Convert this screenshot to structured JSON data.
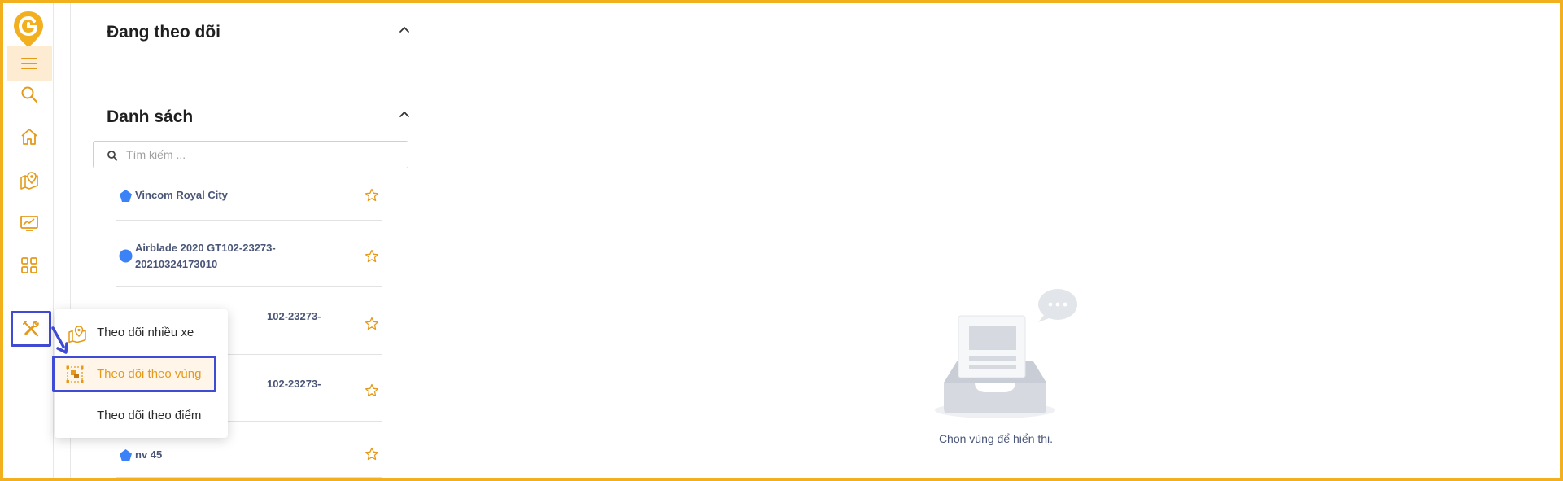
{
  "app": {
    "brand_color": "#f2b01e",
    "accent_color": "#e59a1a",
    "highlight_color": "#3f4bd4",
    "logo_letter": "G"
  },
  "rail": {
    "items": [
      {
        "icon": "menu-icon"
      },
      {
        "icon": "search-icon"
      },
      {
        "icon": "home-icon"
      },
      {
        "icon": "map-pin-icon"
      },
      {
        "icon": "monitor-chart-icon"
      },
      {
        "icon": "apps-grid-icon"
      },
      {
        "icon": "tools-icon"
      }
    ]
  },
  "panel": {
    "following_title": "Đang theo dõi",
    "list_title": "Danh sách",
    "search_placeholder": "Tìm kiếm ...",
    "items": [
      {
        "name": "Vincom Royal City",
        "shape": "pentagon",
        "color": "#3b82f6"
      },
      {
        "name": "Airblade 2020 GT102-23273-20210324173010",
        "shape": "circle",
        "color": "#3b82f6"
      },
      {
        "name": "102-23273-",
        "shape": "circle",
        "color": "#3b82f6"
      },
      {
        "name": "102-23273-",
        "shape": "circle",
        "color": "#3b82f6"
      },
      {
        "name": "nv 45",
        "shape": "pentagon",
        "color": "#3b82f6"
      }
    ]
  },
  "menu": {
    "items": [
      {
        "label": "Theo dõi nhiều xe",
        "icon": "map-marker-icon"
      },
      {
        "label": "Theo dõi theo vùng",
        "icon": "zone-select-icon",
        "selected": true
      },
      {
        "label": "Theo dõi theo điểm",
        "icon": ""
      }
    ]
  },
  "main": {
    "empty_text": "Chọn vùng để hiển thị."
  }
}
